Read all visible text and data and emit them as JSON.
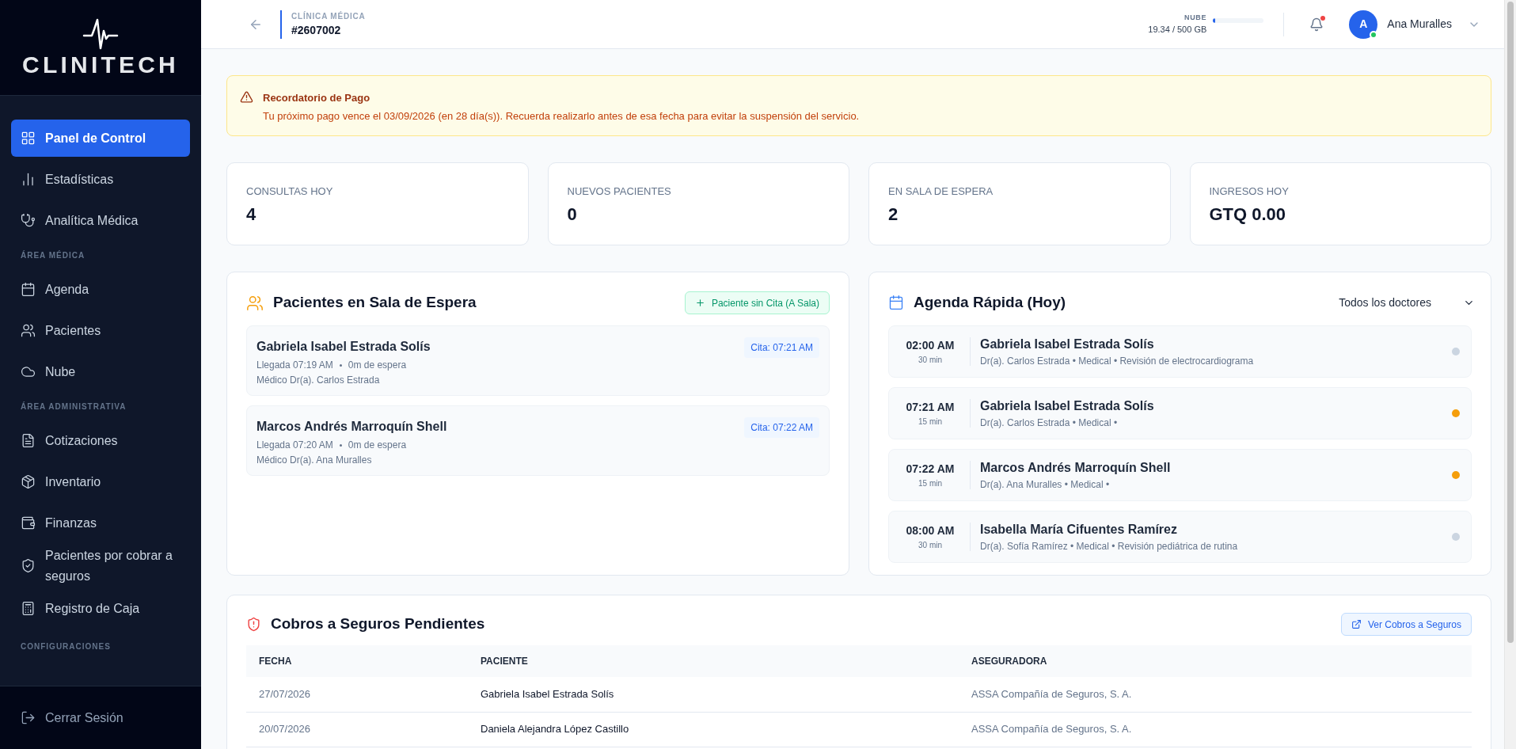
{
  "sidebar": {
    "logo": "CLINITECH",
    "sections": [
      {
        "items": [
          {
            "label": "Panel de Control",
            "selected": true
          },
          {
            "label": "Estadísticas",
            "selected": false
          },
          {
            "label": "Analítica Médica",
            "selected": false
          }
        ]
      },
      {
        "heading": "ÁREA MÉDICA",
        "items": [
          {
            "label": "Agenda",
            "selected": false
          },
          {
            "label": "Pacientes",
            "selected": false
          },
          {
            "label": "Nube",
            "selected": false
          }
        ]
      },
      {
        "heading": "ÁREA ADMINISTRATIVA",
        "items": [
          {
            "label": "Cotizaciones",
            "selected": false
          },
          {
            "label": "Inventario",
            "selected": false
          },
          {
            "label": "Finanzas",
            "selected": false
          },
          {
            "label": "Pacientes por cobrar a seguros",
            "selected": false
          },
          {
            "label": "Registro de Caja",
            "selected": false
          }
        ]
      },
      {
        "heading": "CONFIGURACIONES"
      }
    ],
    "logout": "Cerrar Sesión"
  },
  "header": {
    "subtitle": "CLÍNICA MÉDICA",
    "clinic_id": "#2607002",
    "storage": {
      "label": "NUBE",
      "reading": "19.34 / 500 GB",
      "level": 0.04
    },
    "notifications": {
      "unread": true
    },
    "user": {
      "initial": "A",
      "name": "Ana Muralles",
      "online": true
    }
  },
  "alert": {
    "title": "Recordatorio de Pago",
    "message": "Tu próximo pago vence el 03/09/2026 (en 28 día(s)). Recuerda realizarlo antes de esa fecha para evitar la suspensión del servicio."
  },
  "stats": [
    {
      "label": "CONSULTAS HOY",
      "value": "4"
    },
    {
      "label": "NUEVOS PACIENTES",
      "value": "0"
    },
    {
      "label": "EN SALA DE ESPERA",
      "value": "2"
    },
    {
      "label": "INGRESOS HOY",
      "value": "GTQ 0.00"
    }
  ],
  "waiting_room": {
    "title": "Pacientes en Sala de Espera",
    "button": "Paciente sin Cita (A Sala)",
    "patients": [
      {
        "name": "Gabriela Isabel Estrada Solís",
        "arrival": "Llegada 07:19 AM",
        "wait": "0m de espera",
        "doctor": "Médico Dr(a). Carlos Estrada",
        "appointment": "Cita: 07:21 AM"
      },
      {
        "name": "Marcos Andrés Marroquín Shell",
        "arrival": "Llegada 07:20 AM",
        "wait": "0m de espera",
        "doctor": "Médico Dr(a). Ana Muralles",
        "appointment": "Cita: 07:22 AM"
      }
    ]
  },
  "agenda": {
    "title": "Agenda Rápida (Hoy)",
    "filter": "Todos los doctores",
    "appointments": [
      {
        "time": "02:00 AM",
        "duration": "30 min",
        "patient": "Gabriela Isabel Estrada Solís",
        "details": "Dr(a). Carlos Estrada • Medical • Revisión de electrocardiograma",
        "color": "#cbd5e1"
      },
      {
        "time": "07:21 AM",
        "duration": "15 min",
        "patient": "Gabriela Isabel Estrada Solís",
        "details": "Dr(a). Carlos Estrada • Medical •",
        "color": "#f59e0b"
      },
      {
        "time": "07:22 AM",
        "duration": "15 min",
        "patient": "Marcos Andrés Marroquín Shell",
        "details": "Dr(a). Ana Muralles • Medical •",
        "color": "#f59e0b"
      },
      {
        "time": "08:00 AM",
        "duration": "30 min",
        "patient": "Isabella María Cifuentes Ramírez",
        "details": "Dr(a). Sofía Ramírez • Medical • Revisión pediátrica de rutina",
        "color": "#cbd5e1"
      }
    ]
  },
  "insurance": {
    "title": "Cobros a Seguros Pendientes",
    "button": "Ver Cobros a Seguros",
    "columns": [
      "FECHA",
      "PACIENTE",
      "ASEGURADORA"
    ],
    "rows": [
      [
        "27/07/2026",
        "Gabriela Isabel Estrada Solís",
        "ASSA Compañía de Seguros, S. A."
      ],
      [
        "20/07/2026",
        "Daniela Alejandra López Castillo",
        "ASSA Compañía de Seguros, S. A."
      ]
    ]
  }
}
